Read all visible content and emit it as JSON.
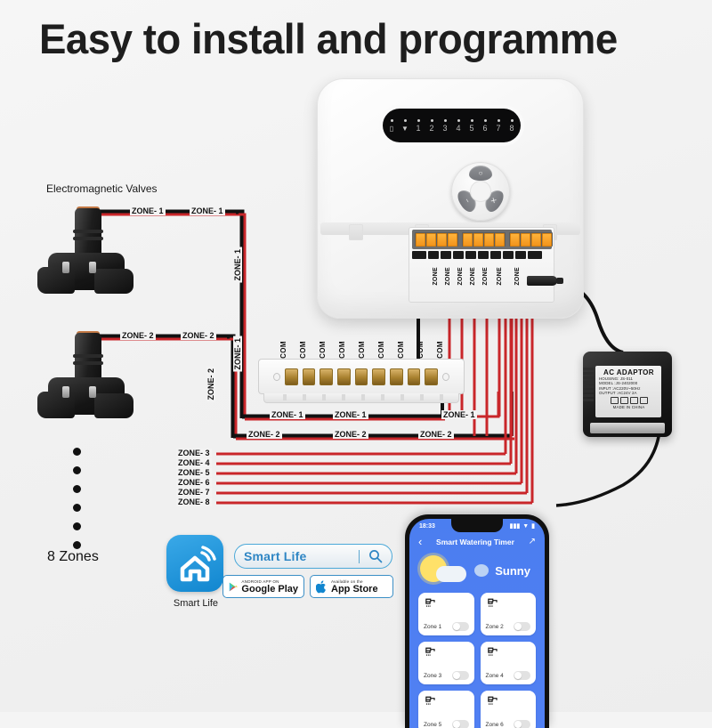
{
  "headline": "Easy to install and  programme",
  "labels": {
    "valves_title": "Electromagnetic Valves",
    "zones_count": "8 Zones",
    "smart_life_caption": "Smart Life"
  },
  "controller": {
    "display": {
      "indicators": [
        {
          "icon": "battery-icon",
          "label": "▯"
        },
        {
          "icon": "wifi-icon",
          "label": "▼"
        },
        {
          "icon": "zone-1-indicator",
          "label": "1"
        },
        {
          "icon": "zone-2-indicator",
          "label": "2"
        },
        {
          "icon": "zone-3-indicator",
          "label": "3"
        },
        {
          "icon": "zone-4-indicator",
          "label": "4"
        },
        {
          "icon": "zone-5-indicator",
          "label": "5"
        },
        {
          "icon": "zone-6-indicator",
          "label": "6"
        },
        {
          "icon": "zone-7-indicator",
          "label": "7"
        },
        {
          "icon": "zone-8-indicator",
          "label": "8"
        }
      ]
    },
    "buttons": [
      {
        "name": "power-button",
        "glyph": "○"
      },
      {
        "name": "minus-button",
        "glyph": "−"
      },
      {
        "name": "plus-button",
        "glyph": "✕"
      }
    ],
    "terminal_zone_labels": [
      "ZONE",
      "ZONE",
      "ZONE",
      "ZONE",
      "ZONE",
      "ZONE",
      "ZONE"
    ]
  },
  "com_strip": {
    "labels": [
      "COM",
      "COM",
      "COM",
      "COM",
      "COM",
      "COM",
      "COM",
      "COM",
      "COM"
    ]
  },
  "wire_labels": {
    "zone1_top_a": "ZONE- 1",
    "zone1_top_b": "ZONE- 1",
    "zone1_vert_a": "ZONE- 1",
    "zone1_vert_b": "ZONE- 1",
    "zone2_top_a": "ZONE- 2",
    "zone2_top_b": "ZONE- 2",
    "zone2_vert_a": "ZONE- 2",
    "zone2_vert_b": "ZONE- 2",
    "zone1_row_a": "ZONE- 1",
    "zone1_row_b": "ZONE- 1",
    "zone1_row_c": "ZONE- 1",
    "zone2_row_a": "ZONE- 2",
    "zone2_row_b": "ZONE- 2",
    "zone2_row_c": "ZONE- 2"
  },
  "zone_list": [
    "ZONE- 3",
    "ZONE- 4",
    "ZONE- 5",
    "ZONE- 6",
    "ZONE- 7",
    "ZONE- 8"
  ],
  "adaptor": {
    "title": "AC  ADAPTOR",
    "lines": [
      "HOUSING: JS-011",
      "MODEL   :JS-2402000",
      "INPUT    :AC220V~50Hz",
      "OUTPUT :AC24V  2A"
    ],
    "made_in": "MADE IN CHINA"
  },
  "smart_life": {
    "search_text": "Smart Life",
    "search_icon": "search-icon",
    "google_play": {
      "sub": "ANDROID APP ON",
      "main": "Google Play"
    },
    "app_store": {
      "sub": "Available on the",
      "main": "App Store"
    }
  },
  "phone": {
    "status": {
      "time": "18:33",
      "signal": "▮▮▮",
      "wifi": "▼",
      "battery": "▮"
    },
    "nav": {
      "back": "‹",
      "title": "Smart Watering Timer",
      "menu": "↗"
    },
    "weather": "Sunny",
    "zones": [
      {
        "label": "Zone 1",
        "state": "off"
      },
      {
        "label": "Zone 2",
        "state": "off"
      },
      {
        "label": "Zone 3",
        "state": "off"
      },
      {
        "label": "Zone 4",
        "state": "off"
      },
      {
        "label": "Zone 5",
        "state": "off"
      },
      {
        "label": "Zone 6",
        "state": "off"
      }
    ]
  },
  "colors": {
    "wire_red": "#c9262a",
    "wire_black": "#111111",
    "accent_blue": "#1186cf",
    "phone_bg": "#4f7ff2",
    "terminal_orange": "#f2941b"
  }
}
